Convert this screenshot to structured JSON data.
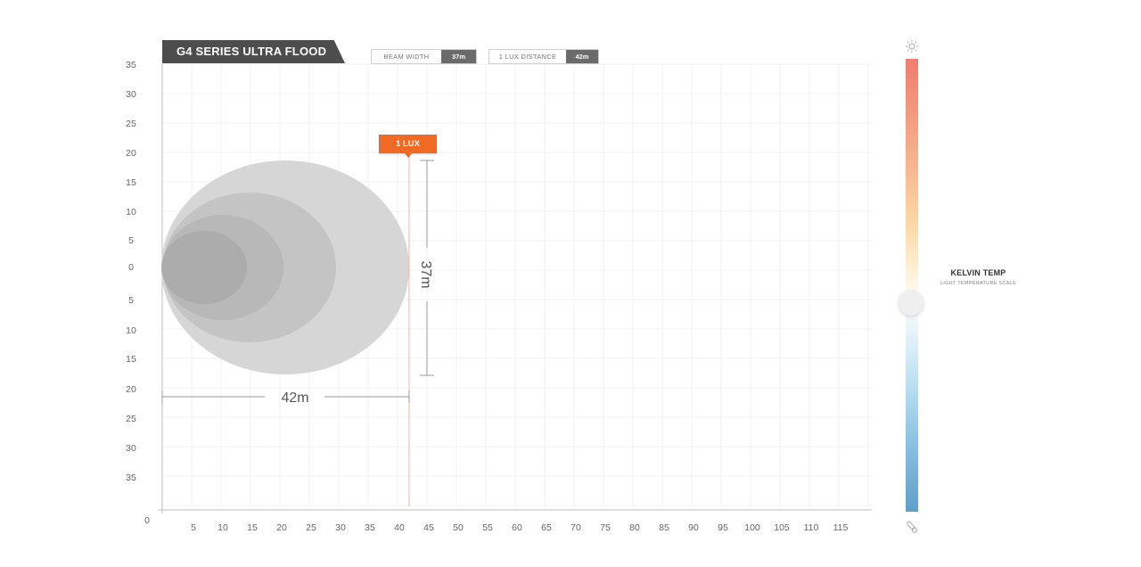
{
  "header": {
    "title": "G4 SERIES ULTRA FLOOD",
    "beam_width": {
      "label": "BEAM WIDTH",
      "value": "37m"
    },
    "lux_distance": {
      "label": "1 LUX DISTANCE",
      "value": "42m"
    }
  },
  "marker": {
    "label": "1 LUX"
  },
  "dimensions": {
    "width_label": "37m",
    "distance_label": "42m"
  },
  "kelvin": {
    "title": "KELVIN TEMP",
    "subtitle": "LIGHT TEMPERATURE SCALE",
    "icon_top": "sun-icon",
    "icon_bottom": "thermometer-icon",
    "level": 0.54
  },
  "axes": {
    "origin": "0",
    "x_ticks": [
      "5",
      "10",
      "15",
      "20",
      "25",
      "30",
      "35",
      "40",
      "45",
      "50",
      "55",
      "60",
      "65",
      "70",
      "75",
      "80",
      "85",
      "90",
      "95",
      "100",
      "105",
      "110",
      "115"
    ],
    "y_ticks_top": [
      "35",
      "30",
      "25",
      "20",
      "15",
      "10",
      "5",
      "0"
    ],
    "y_ticks_bottom": [
      "5",
      "10",
      "15",
      "20",
      "25",
      "30",
      "35"
    ]
  },
  "beam": {
    "distance_m": 42,
    "half_width_m": 18.5
  },
  "colors": {
    "accent": "#ef6a24",
    "title_bg": "#4d4d4d",
    "beam_outer": "#d6d6d6",
    "beam_inner": "#a9a9a9"
  }
}
